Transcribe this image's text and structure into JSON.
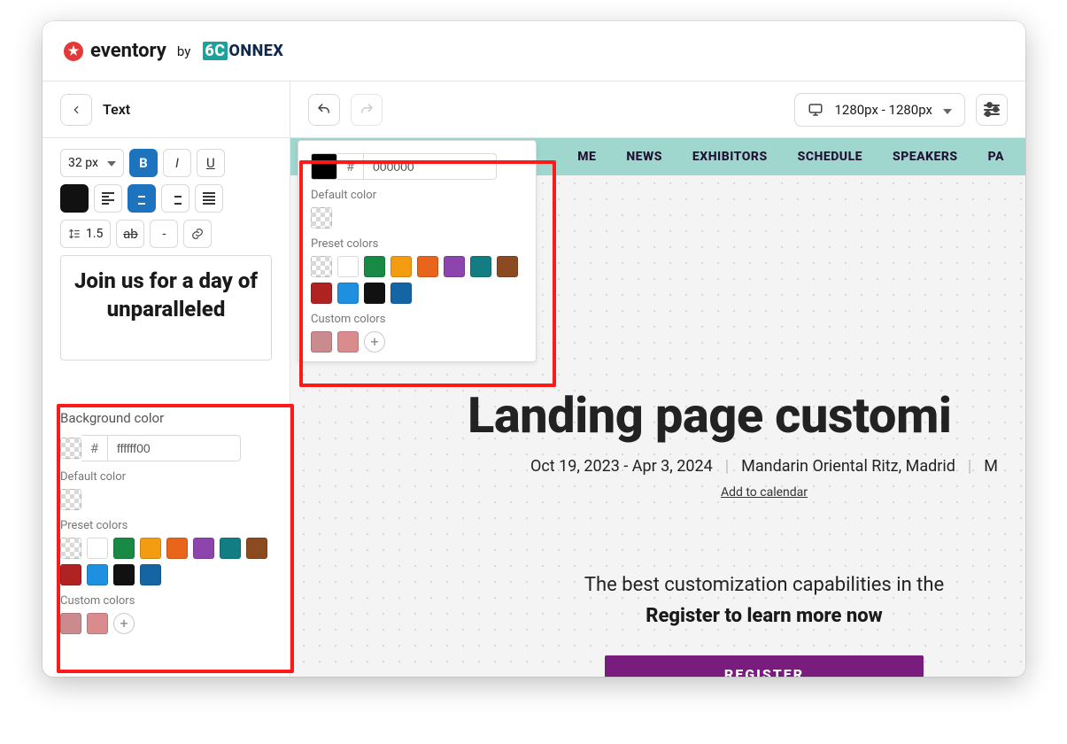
{
  "header": {
    "brand_primary": "eventory",
    "brand_by": "by",
    "brand_secondary_prefix": "6C",
    "brand_secondary_rest": "ONNEX"
  },
  "sidebar": {
    "title": "Text",
    "font_size": "32 px",
    "line_height": "1.5",
    "dash_label": "-",
    "letter_spacing_label": "ab",
    "preview_text": "Join us for a day of unparalleled",
    "bg_color": {
      "title": "Background color",
      "hex": "ffffff00",
      "default_label": "Default color",
      "preset_label": "Preset colors",
      "custom_label": "Custom colors",
      "presets": [
        "transparent",
        "#ffffff",
        "#198a46",
        "#f39c12",
        "#e8651b",
        "#8e44ad",
        "#127e84",
        "#8b4a20",
        "#b02323",
        "#1f8fe0",
        "#111111",
        "#1565a5"
      ],
      "customs": [
        "#c98b8e",
        "#d98b8e"
      ]
    }
  },
  "float_color": {
    "hex": "000000",
    "swatch": "#000000",
    "default_label": "Default color",
    "preset_label": "Preset colors",
    "custom_label": "Custom colors",
    "presets": [
      "transparent",
      "#ffffff",
      "#198a46",
      "#f39c12",
      "#e8651b",
      "#8e44ad",
      "#127e84",
      "#8b4a20",
      "#b02323",
      "#1f8fe0",
      "#111111",
      "#1565a5"
    ],
    "customs": [
      "#c98b8e",
      "#d98b8e"
    ]
  },
  "toolbar": {
    "viewport_label": "1280px - 1280px"
  },
  "canvas": {
    "nav": [
      "ME",
      "NEWS",
      "EXHIBITORS",
      "SCHEDULE",
      "SPEAKERS",
      "PA"
    ],
    "title": "Landing page customi",
    "dates": "Oct 19, 2023 - Apr 3, 2024",
    "venue": "Mandarin Oriental Ritz, Madrid",
    "venue_trail": "M",
    "add_calendar": "Add to calendar",
    "desc": "The best customization capabilities in the",
    "cta_line": "Register to learn more now",
    "register": "REGISTER"
  }
}
